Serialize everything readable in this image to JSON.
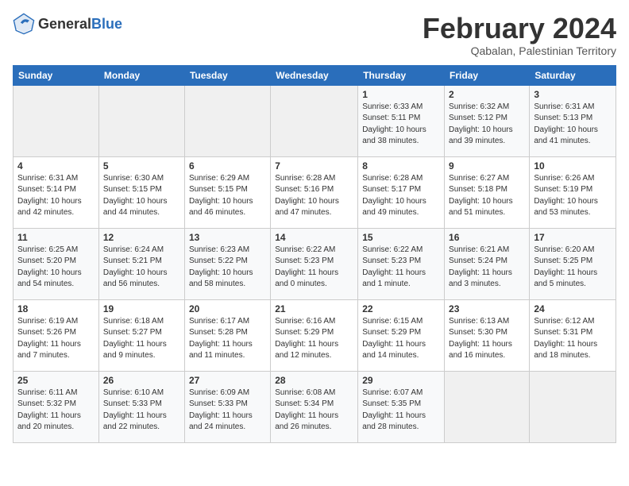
{
  "header": {
    "logo_general": "General",
    "logo_blue": "Blue",
    "month_year": "February 2024",
    "location": "Qabalan, Palestinian Territory"
  },
  "days_of_week": [
    "Sunday",
    "Monday",
    "Tuesday",
    "Wednesday",
    "Thursday",
    "Friday",
    "Saturday"
  ],
  "weeks": [
    [
      {
        "num": "",
        "detail": ""
      },
      {
        "num": "",
        "detail": ""
      },
      {
        "num": "",
        "detail": ""
      },
      {
        "num": "",
        "detail": ""
      },
      {
        "num": "1",
        "detail": "Sunrise: 6:33 AM\nSunset: 5:11 PM\nDaylight: 10 hours\nand 38 minutes."
      },
      {
        "num": "2",
        "detail": "Sunrise: 6:32 AM\nSunset: 5:12 PM\nDaylight: 10 hours\nand 39 minutes."
      },
      {
        "num": "3",
        "detail": "Sunrise: 6:31 AM\nSunset: 5:13 PM\nDaylight: 10 hours\nand 41 minutes."
      }
    ],
    [
      {
        "num": "4",
        "detail": "Sunrise: 6:31 AM\nSunset: 5:14 PM\nDaylight: 10 hours\nand 42 minutes."
      },
      {
        "num": "5",
        "detail": "Sunrise: 6:30 AM\nSunset: 5:15 PM\nDaylight: 10 hours\nand 44 minutes."
      },
      {
        "num": "6",
        "detail": "Sunrise: 6:29 AM\nSunset: 5:15 PM\nDaylight: 10 hours\nand 46 minutes."
      },
      {
        "num": "7",
        "detail": "Sunrise: 6:28 AM\nSunset: 5:16 PM\nDaylight: 10 hours\nand 47 minutes."
      },
      {
        "num": "8",
        "detail": "Sunrise: 6:28 AM\nSunset: 5:17 PM\nDaylight: 10 hours\nand 49 minutes."
      },
      {
        "num": "9",
        "detail": "Sunrise: 6:27 AM\nSunset: 5:18 PM\nDaylight: 10 hours\nand 51 minutes."
      },
      {
        "num": "10",
        "detail": "Sunrise: 6:26 AM\nSunset: 5:19 PM\nDaylight: 10 hours\nand 53 minutes."
      }
    ],
    [
      {
        "num": "11",
        "detail": "Sunrise: 6:25 AM\nSunset: 5:20 PM\nDaylight: 10 hours\nand 54 minutes."
      },
      {
        "num": "12",
        "detail": "Sunrise: 6:24 AM\nSunset: 5:21 PM\nDaylight: 10 hours\nand 56 minutes."
      },
      {
        "num": "13",
        "detail": "Sunrise: 6:23 AM\nSunset: 5:22 PM\nDaylight: 10 hours\nand 58 minutes."
      },
      {
        "num": "14",
        "detail": "Sunrise: 6:22 AM\nSunset: 5:23 PM\nDaylight: 11 hours\nand 0 minutes."
      },
      {
        "num": "15",
        "detail": "Sunrise: 6:22 AM\nSunset: 5:23 PM\nDaylight: 11 hours\nand 1 minute."
      },
      {
        "num": "16",
        "detail": "Sunrise: 6:21 AM\nSunset: 5:24 PM\nDaylight: 11 hours\nand 3 minutes."
      },
      {
        "num": "17",
        "detail": "Sunrise: 6:20 AM\nSunset: 5:25 PM\nDaylight: 11 hours\nand 5 minutes."
      }
    ],
    [
      {
        "num": "18",
        "detail": "Sunrise: 6:19 AM\nSunset: 5:26 PM\nDaylight: 11 hours\nand 7 minutes."
      },
      {
        "num": "19",
        "detail": "Sunrise: 6:18 AM\nSunset: 5:27 PM\nDaylight: 11 hours\nand 9 minutes."
      },
      {
        "num": "20",
        "detail": "Sunrise: 6:17 AM\nSunset: 5:28 PM\nDaylight: 11 hours\nand 11 minutes."
      },
      {
        "num": "21",
        "detail": "Sunrise: 6:16 AM\nSunset: 5:29 PM\nDaylight: 11 hours\nand 12 minutes."
      },
      {
        "num": "22",
        "detail": "Sunrise: 6:15 AM\nSunset: 5:29 PM\nDaylight: 11 hours\nand 14 minutes."
      },
      {
        "num": "23",
        "detail": "Sunrise: 6:13 AM\nSunset: 5:30 PM\nDaylight: 11 hours\nand 16 minutes."
      },
      {
        "num": "24",
        "detail": "Sunrise: 6:12 AM\nSunset: 5:31 PM\nDaylight: 11 hours\nand 18 minutes."
      }
    ],
    [
      {
        "num": "25",
        "detail": "Sunrise: 6:11 AM\nSunset: 5:32 PM\nDaylight: 11 hours\nand 20 minutes."
      },
      {
        "num": "26",
        "detail": "Sunrise: 6:10 AM\nSunset: 5:33 PM\nDaylight: 11 hours\nand 22 minutes."
      },
      {
        "num": "27",
        "detail": "Sunrise: 6:09 AM\nSunset: 5:33 PM\nDaylight: 11 hours\nand 24 minutes."
      },
      {
        "num": "28",
        "detail": "Sunrise: 6:08 AM\nSunset: 5:34 PM\nDaylight: 11 hours\nand 26 minutes."
      },
      {
        "num": "29",
        "detail": "Sunrise: 6:07 AM\nSunset: 5:35 PM\nDaylight: 11 hours\nand 28 minutes."
      },
      {
        "num": "",
        "detail": ""
      },
      {
        "num": "",
        "detail": ""
      }
    ]
  ]
}
